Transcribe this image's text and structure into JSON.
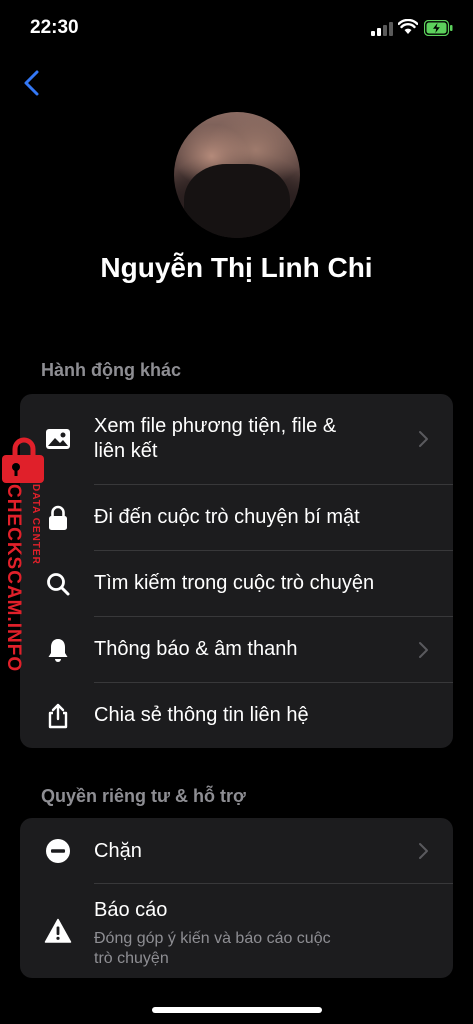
{
  "status_bar": {
    "time": "22:30"
  },
  "profile": {
    "name": "Nguyễn Thị Linh Chi"
  },
  "sections": {
    "more_actions": {
      "title": "Hành động khác",
      "items": [
        {
          "label_line1": "Xem file phương tiện, file &",
          "label_line2": "liên kết",
          "icon": "image-icon",
          "has_chevron": true
        },
        {
          "label": "Đi đến cuộc trò chuyện bí mật",
          "icon": "lock-icon",
          "has_chevron": false
        },
        {
          "label": "Tìm kiếm trong cuộc trò chuyện",
          "icon": "search-icon",
          "has_chevron": false
        },
        {
          "label": "Thông báo & âm thanh",
          "icon": "bell-icon",
          "has_chevron": true
        },
        {
          "label": "Chia sẻ thông tin liên hệ",
          "icon": "share-icon",
          "has_chevron": false
        }
      ]
    },
    "privacy_support": {
      "title": "Quyền riêng tư & hỗ trợ",
      "items": [
        {
          "label": "Chặn",
          "icon": "block-icon",
          "has_chevron": true
        },
        {
          "label": "Báo cáo",
          "sublabel_line1": "Đóng góp ý kiến và báo cáo cuộc",
          "sublabel_line2": "trò chuyện",
          "icon": "warning-icon",
          "has_chevron": false
        }
      ]
    }
  },
  "watermark": {
    "text": "CHECKSCAM.INFO",
    "subtext": "DATA CENTER",
    "color": "#e0202a"
  },
  "colors": {
    "accent": "#3478f6",
    "card": "#1c1c1e",
    "secondary_text": "#8e8e93"
  }
}
